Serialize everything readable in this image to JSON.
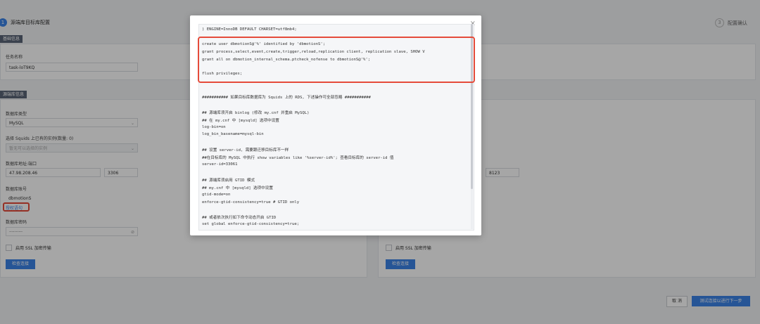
{
  "steps": {
    "step1_num": "1",
    "step1_label": "源端库目标库配置",
    "step3_num": "3",
    "step3_label": "配置确认"
  },
  "basic_section": {
    "tag": "基础信息",
    "task_name_label": "任务名称",
    "task_name_value": "task-loT9KQ"
  },
  "source_section": {
    "tag": "源端库信息",
    "db_type_label": "数据库类型",
    "db_type_value": "MySQL",
    "instance_label": "选择 Squids 上已有的实例(数量: 0)",
    "instance_placeholder": "暂无可以选择的实例",
    "address_label": "数据库地址:端口",
    "host_value": "47.98.208.46",
    "port_value": "3306",
    "account_label": "数据库账号",
    "account_value": "dbmotionS",
    "grant_link": "授权语句",
    "password_label": "数据库密码",
    "password_value": "··········",
    "ssl_label": "启用 SSL 加密传输",
    "check_button": "检查连接"
  },
  "target_section": {
    "port_value": "8123",
    "ssl_label": "启用 SSL 加密传输",
    "check_button": "检查连接"
  },
  "footer": {
    "cancel_button": "取 消",
    "next_button": "测试连接以进行下一步"
  },
  "modal": {
    "close_glyph": "×",
    "lines": [
      ") ENGINE=InnoDB DEFAULT CHARSET=utf8mb4;",
      "create user dbmotionS@'%' identified by 'dbmotionS';",
      "grant process,select,event,create,trigger,reload,replication client, replication slave, SHOW V",
      "grant all on dbmotion_internal_schema.ptcheck_nofense to dbmotionS@'%';",
      "flush privileges;",
      "########### 如果目标库数据库为 Squids 上的 RDS, 下述操作可全部忽略 ###########",
      "## 源端库须开启 binlog (修改 my.cnf 并重启 MySQL)",
      "## 在 my.cnf 中 [mysqld] 选项中设置",
      "log-bin=on",
      "log_bin_basename=mysql-bin",
      "## 设置 server-id, 需要跟迁移目标库不一样",
      "##在目标库的 MySQL 中执行 show variables like '%server-id%'; 查看目标库的 server-id 值",
      "server-id=33061",
      "## 源端库须启用 GTID 模式",
      "## my.cnf 中 [mysqld] 选项中设置",
      "gtid-mode=on",
      "enforce-gtid-consistency=true # GTID only",
      "## 或者依次执行如下命令动态开启 GTID",
      "set global enforce-gtid-consistency=true;"
    ]
  }
}
